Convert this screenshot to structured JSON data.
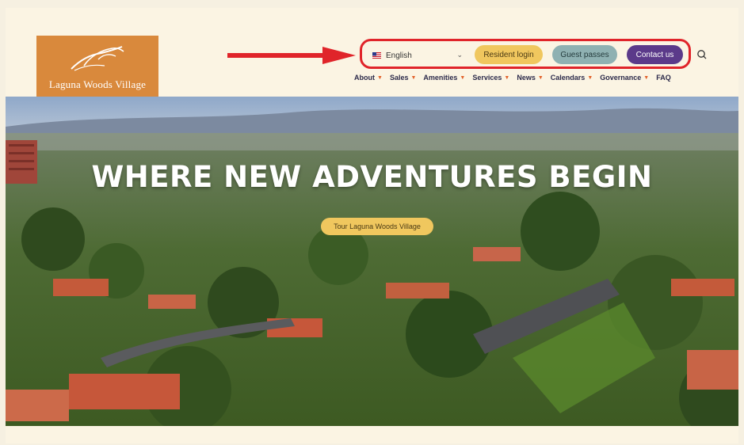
{
  "header": {
    "logo_text": "Laguna Woods Village",
    "language": {
      "selected": "English",
      "flag": "us-flag-icon"
    },
    "buttons": {
      "resident_login": "Resident login",
      "guest_passes": "Guest passes",
      "contact_us": "Contact us"
    },
    "search_icon": "search-icon"
  },
  "nav": {
    "items": [
      {
        "label": "About",
        "dropdown": true
      },
      {
        "label": "Sales",
        "dropdown": true
      },
      {
        "label": "Amenities",
        "dropdown": true
      },
      {
        "label": "Services",
        "dropdown": true
      },
      {
        "label": "News",
        "dropdown": true
      },
      {
        "label": "Calendars",
        "dropdown": true
      },
      {
        "label": "Governance",
        "dropdown": true
      },
      {
        "label": "FAQ",
        "dropdown": false
      }
    ]
  },
  "hero": {
    "title": "WHERE NEW ADVENTURES BEGIN",
    "cta": "Tour Laguna Woods Village"
  },
  "colors": {
    "brand_orange": "#d9893c",
    "accent_yellow": "#f0c75e",
    "accent_teal": "#8fb1b2",
    "accent_purple": "#5b3a8a",
    "annotation_red": "#e0242a",
    "nav_caret": "#e2612a"
  }
}
